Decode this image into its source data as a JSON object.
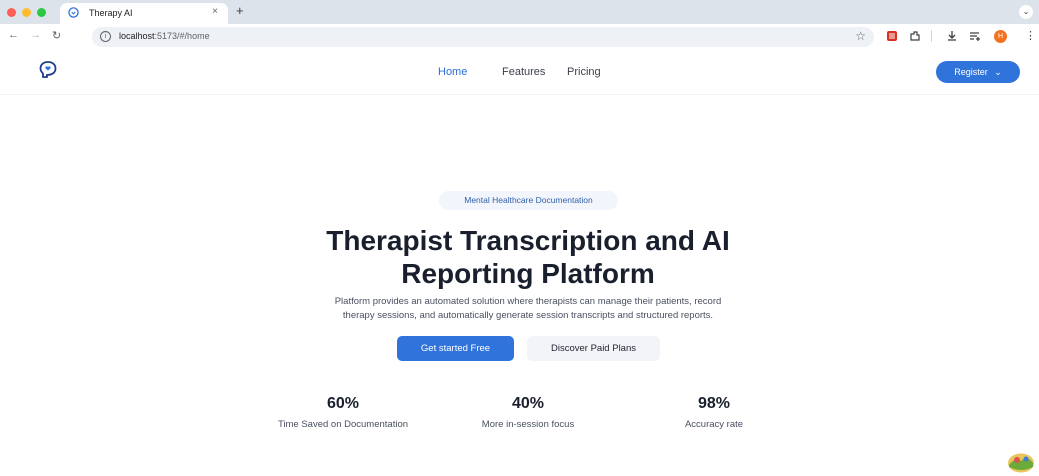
{
  "browser": {
    "tab_title": "Therapy AI",
    "tab_close": "×",
    "new_tab": "+",
    "tab_menu": "⌄",
    "url_host": "localhost",
    "url_path": ":5173/#/home",
    "profile_initial": "H",
    "colors": {
      "close": "#ff5f57",
      "minimize": "#febc2e",
      "maximize": "#28c840",
      "profile": "#f4721e",
      "ext_red": "#d93025"
    }
  },
  "nav": {
    "links": [
      "Home",
      "Features",
      "Pricing"
    ],
    "active": "Home",
    "register_label": "Register",
    "brand_color": "#2f73db"
  },
  "hero": {
    "badge": "Mental Healthcare Documentation",
    "title_line1": "Therapist Transcription and AI",
    "title_line2": "Reporting Platform",
    "subtitle_line1": "Platform provides an automated solution where therapists can manage their patients, record",
    "subtitle_line2": "therapy sessions, and automatically generate session transcripts and structured reports.",
    "primary_cta": "Get started Free",
    "secondary_cta": "Discover Paid Plans"
  },
  "stats": [
    {
      "value": "60%",
      "label": "Time Saved on Documentation"
    },
    {
      "value": "40%",
      "label": "More in-session focus"
    },
    {
      "value": "98%",
      "label": "Accuracy rate"
    }
  ]
}
